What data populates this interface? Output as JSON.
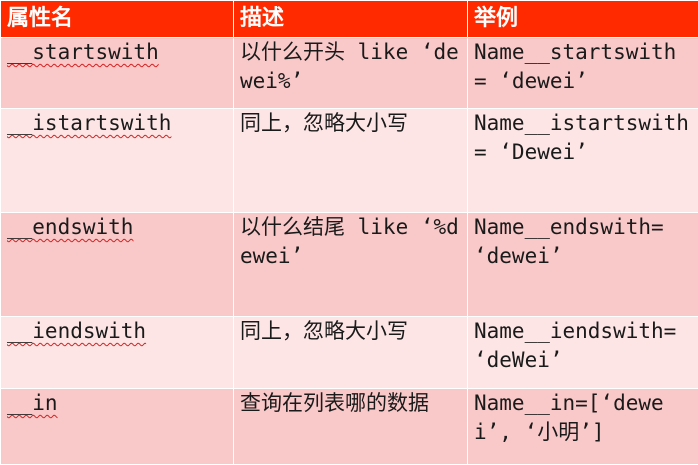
{
  "header": {
    "col1": "属性名",
    "col2": "描述",
    "col3": "举例"
  },
  "rows": [
    {
      "attr": "__startswith",
      "desc": "以什么开头 like ‘dewei%’",
      "example": "Name__startswith = ‘dewei’"
    },
    {
      "attr": "__istartswith",
      "desc": "同上，忽略大小写",
      "example": "Name__istartswith= ‘Dewei’"
    },
    {
      "attr": "__endswith",
      "desc": "以什么结尾 like ‘%dewei’",
      "example": "Name__endswith= ‘dewei’"
    },
    {
      "attr": "__iendswith",
      "desc": "同上，忽略大小写",
      "example": "Name__iendswith= ‘deWei’"
    },
    {
      "attr": "__in",
      "desc": "查询在列表哪的数据",
      "example": "Name__in=[‘dewei’, ‘小明’]"
    }
  ],
  "colors": {
    "header_bg": "#ff2a00",
    "row_odd_bg": "#f9c8c8",
    "row_even_bg": "#fde5e5",
    "spellcheck_underline": "#d42020"
  }
}
